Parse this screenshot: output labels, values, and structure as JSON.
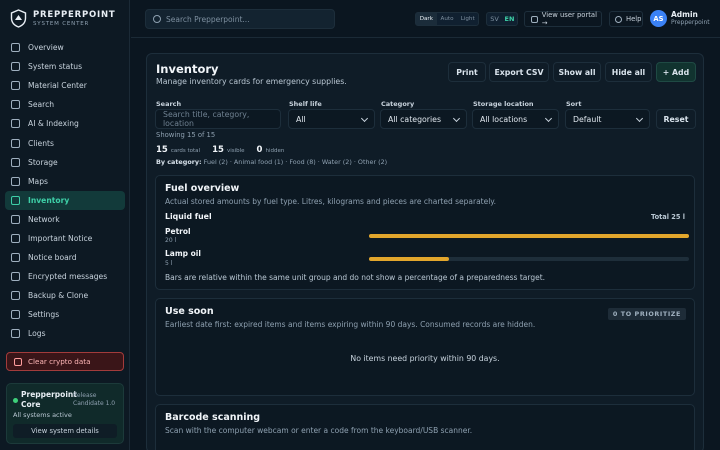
{
  "brand": {
    "title": "PREPPERPOINT",
    "subtitle": "SYSTEM CENTER"
  },
  "nav": [
    {
      "label": "Overview",
      "icon": "grid-icon"
    },
    {
      "label": "System status",
      "icon": "pulse-icon"
    },
    {
      "label": "Material Center",
      "icon": "box-icon"
    },
    {
      "label": "Search",
      "icon": "search-icon"
    },
    {
      "label": "AI & Indexing",
      "icon": "sparkle-icon"
    },
    {
      "label": "Clients",
      "icon": "users-icon"
    },
    {
      "label": "Storage",
      "icon": "database-icon"
    },
    {
      "label": "Maps",
      "icon": "map-icon"
    },
    {
      "label": "Inventory",
      "icon": "inventory-icon",
      "active": true
    },
    {
      "label": "Network",
      "icon": "network-icon"
    },
    {
      "label": "Important Notice",
      "icon": "bell-icon"
    },
    {
      "label": "Notice board",
      "icon": "clipboard-icon"
    },
    {
      "label": "Encrypted messages",
      "icon": "lock-icon"
    },
    {
      "label": "Backup & Clone",
      "icon": "copy-icon"
    },
    {
      "label": "Settings",
      "icon": "gear-icon"
    },
    {
      "label": "Logs",
      "icon": "file-icon"
    }
  ],
  "crypto_label": "Clear crypto data",
  "core": {
    "name": "Prepperpoint Core",
    "release": "Release Candidate 1.0",
    "status": "All systems active",
    "details_label": "View system details",
    "status_color": "#3ed07a"
  },
  "topbar": {
    "search_placeholder": "Search Prepperpoint...",
    "theme": [
      "Dark",
      "Auto",
      "Light"
    ],
    "lang": [
      "SV",
      "EN"
    ],
    "portal_label": "View user portal →",
    "help_label": "Help",
    "avatar": "AS",
    "user_name": "Admin",
    "user_role": "Prepperpoint"
  },
  "page": {
    "title": "Inventory",
    "subtitle": "Manage inventory cards for emergency supplies.",
    "actions": {
      "print": "Print",
      "export": "Export CSV",
      "show_all": "Show all",
      "hide_all": "Hide all",
      "add": "+ Add"
    }
  },
  "filters": {
    "search_label": "Search",
    "search_placeholder": "Search title, category, location",
    "shelf_label": "Shelf life",
    "shelf_value": "All",
    "category_label": "Category",
    "category_value": "All categories",
    "location_label": "Storage location",
    "location_value": "All locations",
    "sort_label": "Sort",
    "sort_value": "Default",
    "reset": "Reset"
  },
  "summary": {
    "showing": "Showing 15 of 15",
    "total": "15",
    "total_label": "cards total",
    "visible": "15",
    "visible_label": "visible",
    "hidden": "0",
    "hidden_label": "hidden",
    "bycat_label": "By category:",
    "bycat": "Fuel (2) · Animal food (1) · Food (8) · Water (2) · Other (2)"
  },
  "fuel": {
    "title": "Fuel overview",
    "subtitle": "Actual stored amounts by fuel type. Litres, kilograms and pieces are charted separately.",
    "group": "Liquid fuel",
    "group_total": "Total 25 l",
    "items": [
      {
        "name": "Petrol",
        "amount": "20 l",
        "fraction": 1.0
      },
      {
        "name": "Lamp oil",
        "amount": "5 l",
        "fraction": 0.25
      }
    ],
    "note": "Bars are relative within the same unit group and do not show a percentage of a preparedness target.",
    "bar_color": "#e2a62c"
  },
  "use_soon": {
    "title": "Use soon",
    "subtitle": "Earliest date first: expired items and items expiring within 90 days. Consumed records are hidden.",
    "badge": "0 TO PRIORITIZE",
    "empty": "No items need priority within 90 days."
  },
  "barcode": {
    "title": "Barcode scanning",
    "subtitle": "Scan with the computer webcam or enter a code from the keyboard/USB scanner."
  }
}
